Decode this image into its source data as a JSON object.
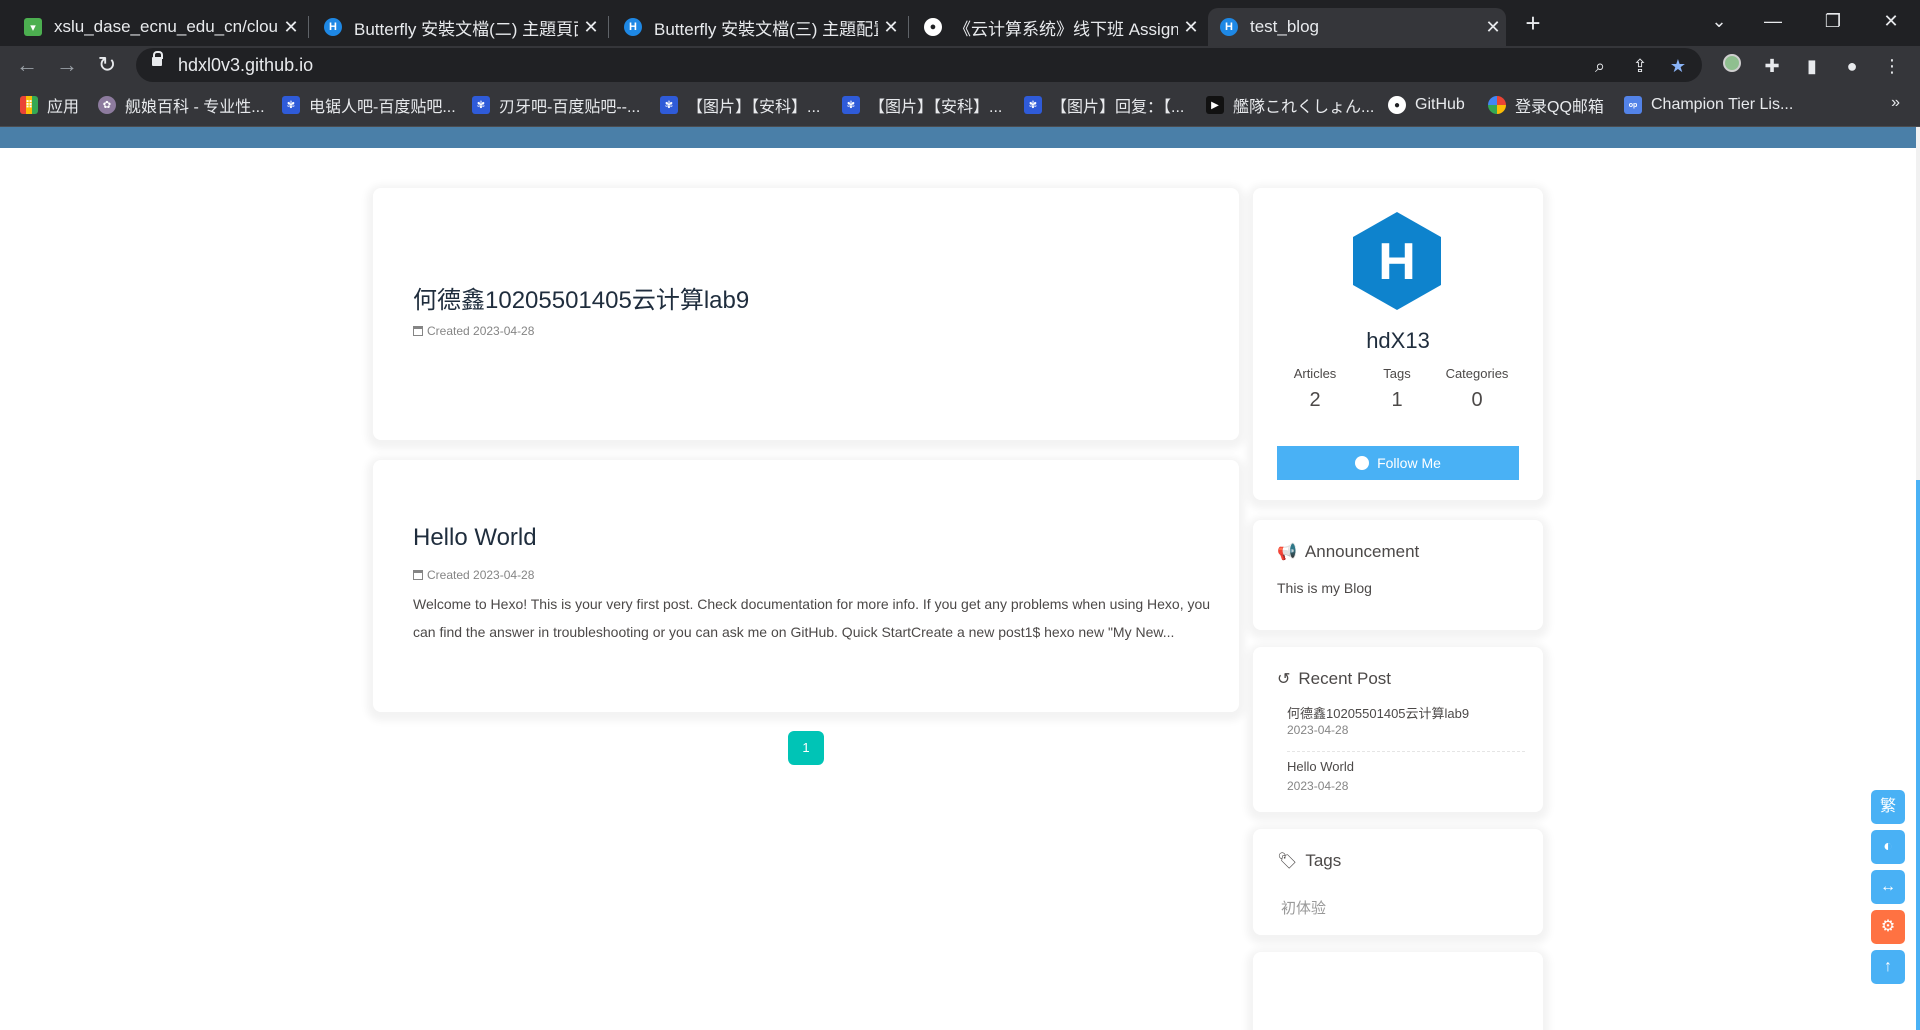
{
  "browser": {
    "tabs": [
      {
        "title": "xslu_dase_ecnu_edu_cn/cloud",
        "icon": "gitlab-icon",
        "color": "#4caf50",
        "active": false
      },
      {
        "title": "Butterfly 安裝文檔(二) 主題頁面",
        "icon": "hexo-icon",
        "color": "#1e88e5",
        "active": false
      },
      {
        "title": "Butterfly 安裝文檔(三) 主題配置",
        "icon": "hexo-icon",
        "color": "#1e88e5",
        "active": false
      },
      {
        "title": "《云计算系统》线下班 Assignment",
        "icon": "github-icon",
        "color": "#ffffff",
        "active": false
      },
      {
        "title": "test_blog",
        "icon": "hexo-icon",
        "color": "#1e88e5",
        "active": true
      }
    ],
    "url": "hdxl0v3.github.io",
    "bookmarks": [
      {
        "label": "应用",
        "icon": "apps-grid-icon"
      },
      {
        "label": "舰娘百科 - 专业性...",
        "icon": "moegirl-icon"
      },
      {
        "label": "电锯人吧-百度贴吧...",
        "icon": "baidu-paw-icon"
      },
      {
        "label": "刃牙吧-百度贴吧--...",
        "icon": "baidu-paw-icon"
      },
      {
        "label": "【图片】【安科】...",
        "icon": "baidu-paw-icon"
      },
      {
        "label": "【图片】【安科】...",
        "icon": "baidu-paw-icon"
      },
      {
        "label": "【图片】回复：【...",
        "icon": "baidu-paw-icon"
      },
      {
        "label": "艦隊これくしょん...",
        "icon": "kancolle-icon"
      },
      {
        "label": "GitHub",
        "icon": "github-icon"
      },
      {
        "label": "登录QQ邮箱",
        "icon": "qq-mail-icon"
      },
      {
        "label": "Champion Tier Lis...",
        "icon": "opgg-icon"
      }
    ],
    "bookmarks_more": "»"
  },
  "posts": [
    {
      "title": "何德鑫10205501405云计算lab9",
      "meta": "Created 2023-04-28",
      "excerpt": ""
    },
    {
      "title": "Hello World",
      "meta": "Created 2023-04-28",
      "excerpt": "Welcome to Hexo! This is your very first post. Check documentation for more info. If you get any problems when using Hexo, you can find the answer in troubleshooting or you can ask me on GitHub. Quick StartCreate a new post1$ hexo new \"My New..."
    }
  ],
  "pagination": {
    "current": "1"
  },
  "author": {
    "name": "hdX13",
    "avatar_letter": "H",
    "stats": [
      {
        "label": "Articles",
        "value": "2"
      },
      {
        "label": "Tags",
        "value": "1"
      },
      {
        "label": "Categories",
        "value": "0"
      }
    ],
    "follow_label": "Follow Me"
  },
  "announcement": {
    "title": "Announcement",
    "text": "This is my Blog"
  },
  "recent": {
    "title": "Recent Post",
    "items": [
      {
        "title": "何德鑫10205501405云计算lab9",
        "date": "2023-04-28"
      },
      {
        "title": "Hello World",
        "date": "2023-04-28"
      }
    ]
  },
  "tags": {
    "title": "Tags",
    "items": [
      "初体验"
    ]
  },
  "rightside": {
    "translate": "繁",
    "colors": {
      "accent": "#49b1f5",
      "settings": "#ff7242"
    }
  }
}
